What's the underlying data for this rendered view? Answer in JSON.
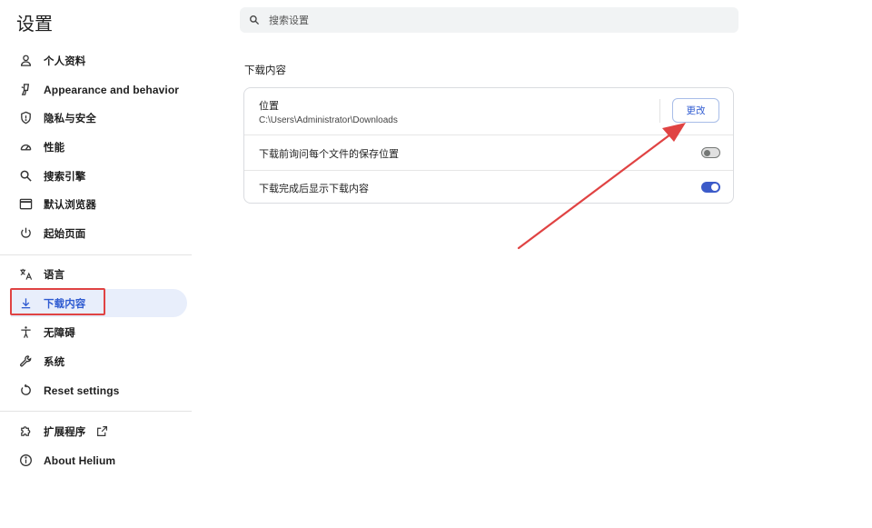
{
  "app": {
    "title": "设置"
  },
  "search": {
    "placeholder": "搜索设置"
  },
  "sidebar": {
    "items": [
      {
        "label": "个人资料",
        "icon": "person-icon"
      },
      {
        "label": "Appearance and behavior",
        "icon": "paint-icon"
      },
      {
        "label": "隐私与安全",
        "icon": "shield-icon"
      },
      {
        "label": "性能",
        "icon": "speedometer-icon"
      },
      {
        "label": "搜索引擎",
        "icon": "search-icon"
      },
      {
        "label": "默认浏览器",
        "icon": "browser-icon"
      },
      {
        "label": "起始页面",
        "icon": "power-icon"
      },
      {
        "label": "语言",
        "icon": "translate-icon"
      },
      {
        "label": "下载内容",
        "icon": "download-icon",
        "active": true
      },
      {
        "label": "无障碍",
        "icon": "accessibility-icon"
      },
      {
        "label": "系统",
        "icon": "wrench-icon"
      },
      {
        "label": "Reset settings",
        "icon": "reset-icon"
      },
      {
        "label": "扩展程序",
        "icon": "puzzle-icon",
        "external": true
      },
      {
        "label": "About Helium",
        "icon": "info-icon"
      }
    ]
  },
  "downloads": {
    "section_title": "下载内容",
    "location_label": "位置",
    "location_path": "C:\\Users\\Administrator\\Downloads",
    "change_button": "更改",
    "ask_label": "下载前询问每个文件的保存位置",
    "ask_enabled": false,
    "show_label": "下载完成后显示下载内容",
    "show_enabled": true
  },
  "colors": {
    "accent": "#2f5bd1",
    "active_bg": "#e8eefb",
    "annotation_red": "#e04343",
    "toggle_on": "#3c5bc9"
  }
}
